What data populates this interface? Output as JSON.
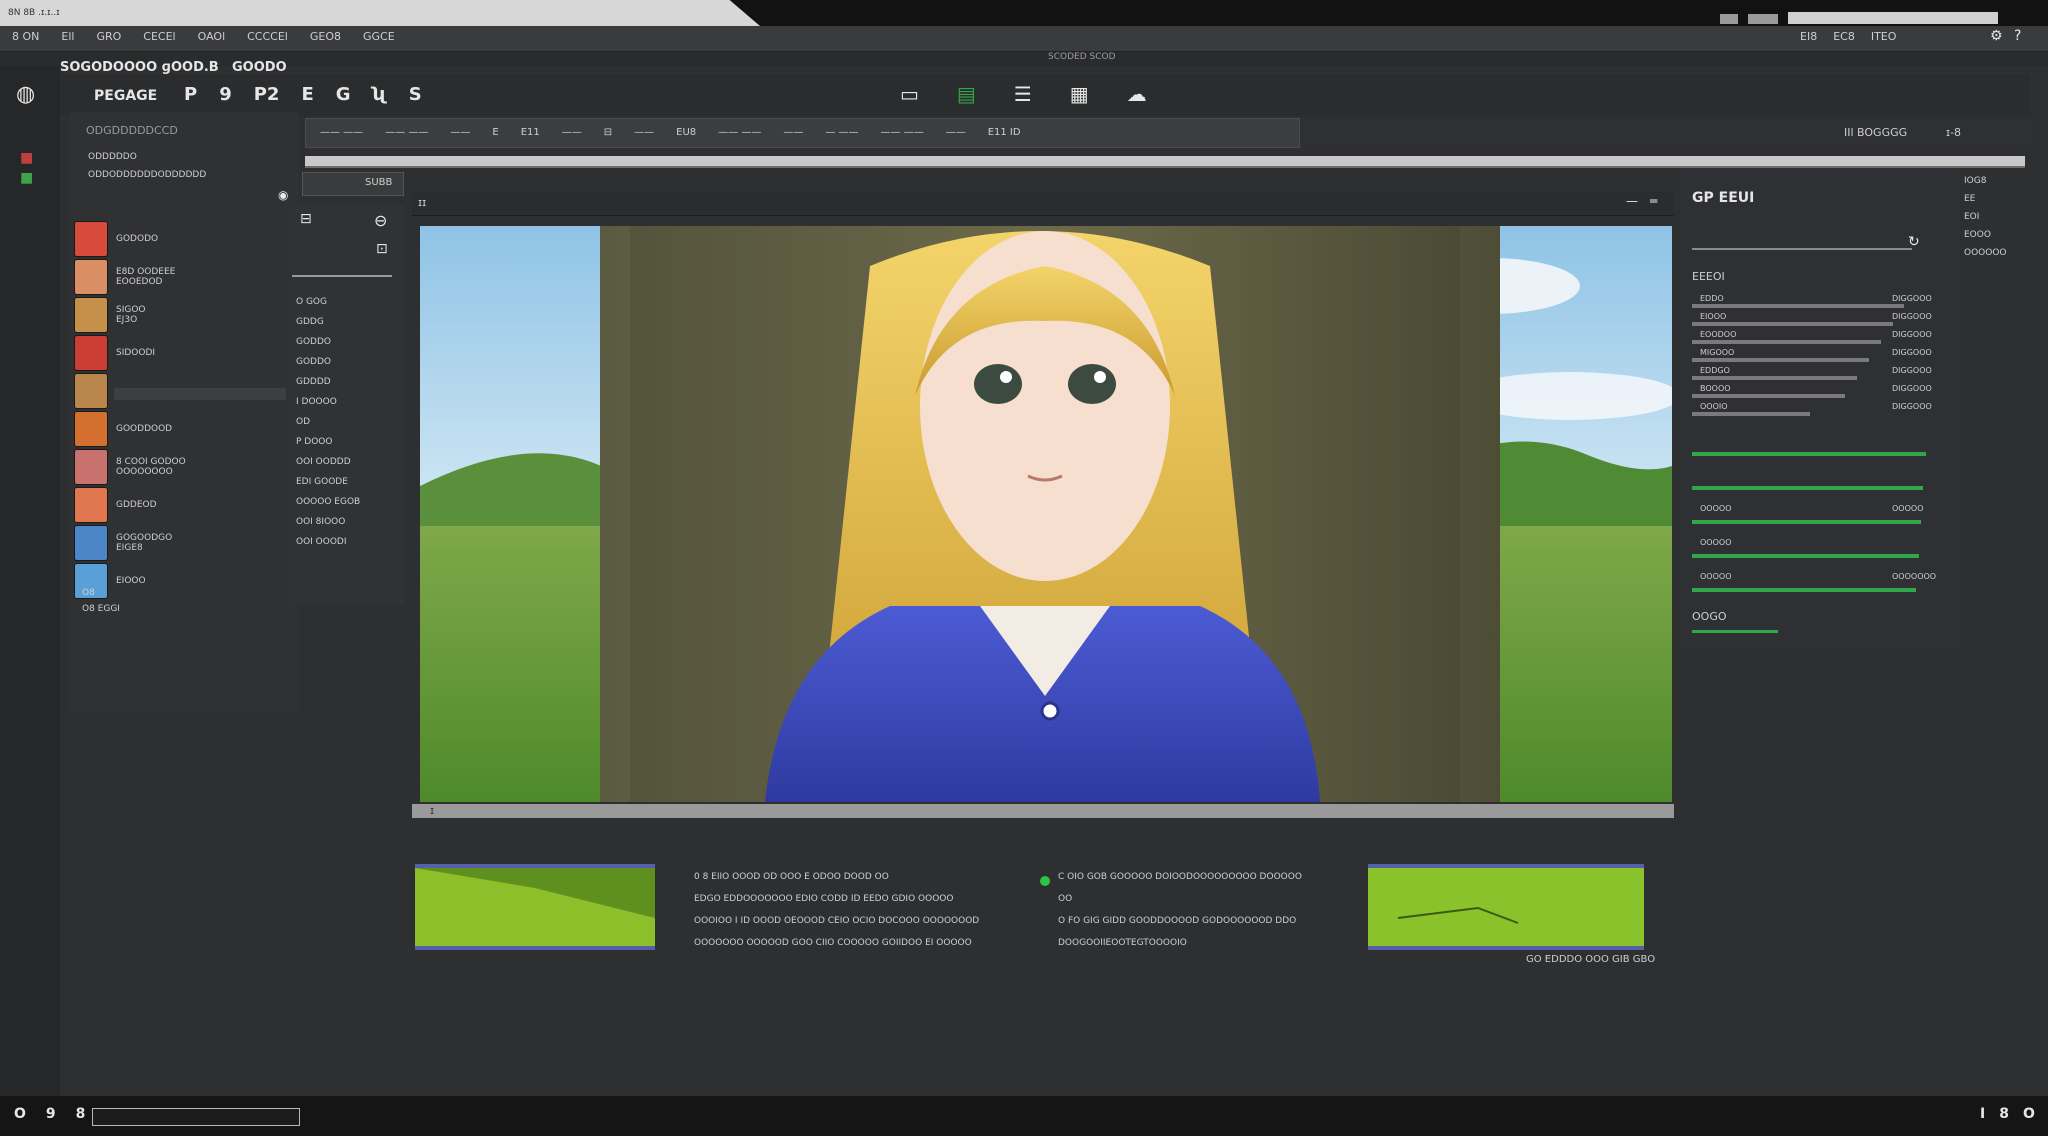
{
  "app": {
    "os_title": "8N 8B .ɪ.ɪ..ɪ",
    "menu": [
      "8 ON",
      "Ell",
      "GRO",
      "CECEl",
      "OAOl",
      "CCCCEl",
      "GEO8",
      "GGCE"
    ],
    "menu_right": [
      "EI8",
      "EC8",
      "ITEO"
    ],
    "document_tab": "SCODED SCOD"
  },
  "toolbar": {
    "title": "SOGODOOOO ɡOOD.B",
    "title2": "GOODO",
    "mode_label": "PEGAGE",
    "items": [
      "P",
      "9",
      "P2",
      "E",
      "G",
      "ʯ",
      "S"
    ],
    "center_items": [
      "▭",
      "▤",
      "☰",
      "▦",
      "☁"
    ]
  },
  "options_bar": {
    "items": [
      "——  ——",
      "—— ——",
      "——",
      "E",
      "E11",
      "——",
      "⊟",
      "——",
      "EU8",
      "—— ——",
      "——",
      "— ——",
      "—— ——",
      "——",
      "E11 ID"
    ],
    "right_label": "IIl BOGGGG",
    "right_value": "ɪ-8"
  },
  "layers": {
    "header": "ODGDDDDDCCD",
    "subheader": "ODDDDDO",
    "subheader2": "ODDODDDDDDODDDDDD",
    "search_value": "SUBB",
    "items": [
      {
        "label": "GODODO",
        "color": "#d84a3c"
      },
      {
        "label": "E8D OODEEE",
        "label2": "EOOEDOD",
        "color": "#d98f63"
      },
      {
        "label": "SIGOO",
        "label2": "EJ3O",
        "color": "#c5904a"
      },
      {
        "label": "SIDOODI",
        "color": "#cc3d34"
      },
      {
        "label": "",
        "color": "#b9874c"
      },
      {
        "label": "GOODDOOD",
        "color": "#d4702f"
      },
      {
        "label": "8 COOI GODOO",
        "label2": "OOOOOOOO",
        "color": "#c8716d"
      },
      {
        "label": "GDDEOD",
        "color": "#e0774e"
      },
      {
        "label": "GOGOODGO",
        "label2": "EIGE8",
        "color": "#4c86c8"
      },
      {
        "label": "EIOOO",
        "color": "#5aa0d8"
      }
    ],
    "footer": [
      "O8",
      "O8 EGGI"
    ]
  },
  "properties": {
    "items": [
      "O GOG",
      "GDDG",
      "GODDO",
      "GODDO",
      "GDDDD",
      "I DOOOO",
      "OD",
      "P  DOOO",
      "OOI OODDD",
      "EDI GOODE",
      "OOOOO EGOB",
      "OOI 8IOOO",
      "OOI OOODI"
    ]
  },
  "document": {
    "icon": "ɪɪ",
    "scroll_marker": "ɪ"
  },
  "bottom_panel": {
    "col1": [
      "0  8  EIIO OOOD   OD  OOO  E ODOO  DOOD  OO",
      "EDGO  EDDOOOOOOO  EDIO  CODD ID  EEDO  GDIO OOOOO",
      "OOOIOO I ID OOOD OEOOOD CEIO OCIO DOCOOO OOOOOOOD",
      "OOOOOOO OOOOOD GOO CIIO COOOOO  GOIIDOO EI OOOOO"
    ],
    "col2": [
      "C  OIO  GOB  GOOOOO  DOIOODOOOOOOOOO  DOOOOO",
      "OO",
      "O  FO  GIG  GIDD  GOODDOOOOD GODOOOOOOD DDO",
      "DOOGOOIIEOOTEGTOOOOIO"
    ],
    "caption": "GO EDDDO  OOO  GIB GBO",
    "status_dot": "#2ec44a"
  },
  "right_panel": {
    "title": "GP EEUI",
    "header": "EEEOI",
    "rows": [
      {
        "label": "EDDO",
        "value": "DIGGOOO",
        "level": 0.9
      },
      {
        "label": "EIOOO",
        "value": "DIGGOOO",
        "level": 0.85
      },
      {
        "label": "EOODOO",
        "value": "DIGGOOO",
        "level": 0.8
      },
      {
        "label": "MIGOOO",
        "value": "DIGGOOO",
        "level": 0.75
      },
      {
        "label": "EDDGO",
        "value": "DIGGOOO",
        "level": 0.7
      },
      {
        "label": "BOOOO",
        "value": "DIGGOOO",
        "level": 0.65
      },
      {
        "label": "OOOIO",
        "value": "DIGGOOO",
        "level": 0.5
      }
    ],
    "green_rows": [
      {
        "label": "",
        "value": "",
        "level": 0.99
      },
      {
        "label": "",
        "value": "",
        "level": 0.98
      },
      {
        "label": "OOOOO",
        "value": "OOOOO",
        "level": 0.97
      },
      {
        "label": "OOOOO",
        "value": "",
        "level": 0.96
      },
      {
        "label": "OOOOO",
        "value": "OOOOOOO",
        "level": 0.95
      }
    ],
    "footer_label": "OOGO",
    "far_right": [
      "IOG8",
      "EE",
      "EOI",
      "EOOO",
      "OOOOOO"
    ]
  },
  "statusbar": {
    "left": [
      "O",
      "9",
      "8"
    ],
    "input_value": "",
    "right": [
      "I",
      "8",
      "O"
    ]
  },
  "colors": {
    "accent_green": "#2fa64a",
    "accent_blue": "#5560a8",
    "canvas_bg": "#2e2f31"
  }
}
